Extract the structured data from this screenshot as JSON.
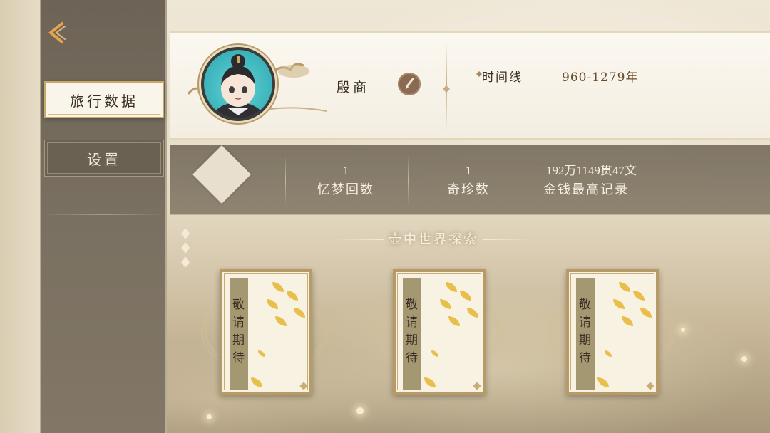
{
  "sidebar": {
    "back_icon": "chevron-left-icon",
    "tabs": [
      {
        "label": "旅行数据",
        "active": true
      },
      {
        "label": "设置",
        "active": false
      }
    ]
  },
  "profile": {
    "name": "殷商",
    "edit_icon": "brush-icon",
    "timeline_label": "时间线",
    "timeline_value": "960-1279年"
  },
  "stats": [
    {
      "value": "1",
      "label": "忆梦回数"
    },
    {
      "value": "1",
      "label": "奇珍数"
    },
    {
      "value": "192万1149贯47文",
      "label": "金钱最高记录"
    }
  ],
  "exploration": {
    "title": "壶中世界探索",
    "cards": [
      {
        "text": "敬请期待"
      },
      {
        "text": "敬请期待"
      },
      {
        "text": "敬请期待"
      }
    ]
  },
  "colors": {
    "sidebar": "#6d6356",
    "accent_gold": "#c9a96a",
    "panel_light": "#fbf8f1",
    "stats_band": "#6e6454"
  }
}
